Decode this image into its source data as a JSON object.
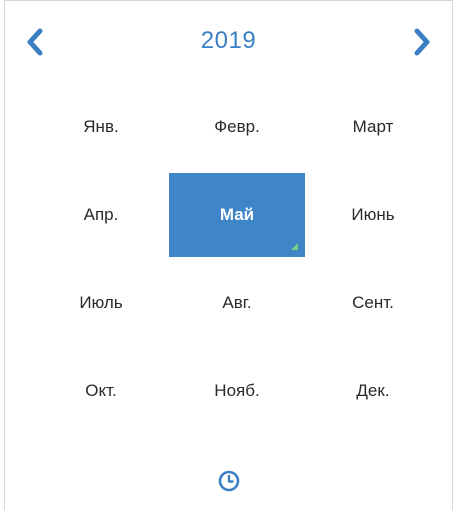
{
  "header": {
    "year": "2019",
    "prev_icon": "chevron-left-icon",
    "next_icon": "chevron-right-icon"
  },
  "months": [
    {
      "label": "Янв."
    },
    {
      "label": "Февр."
    },
    {
      "label": "Март"
    },
    {
      "label": "Апр."
    },
    {
      "label": "Май",
      "selected": true
    },
    {
      "label": "Июнь"
    },
    {
      "label": "Июль"
    },
    {
      "label": "Авг."
    },
    {
      "label": "Сент."
    },
    {
      "label": "Окт."
    },
    {
      "label": "Нояб."
    },
    {
      "label": "Дек."
    }
  ],
  "footer": {
    "icon": "clock-icon"
  },
  "colors": {
    "accent": "#3a7fc4",
    "selected_bg": "#3f86c9",
    "selected_text": "#ffffff",
    "text": "#2a2a2a",
    "corner_marker": "#7fd07a",
    "border": "#d6d6d6"
  }
}
